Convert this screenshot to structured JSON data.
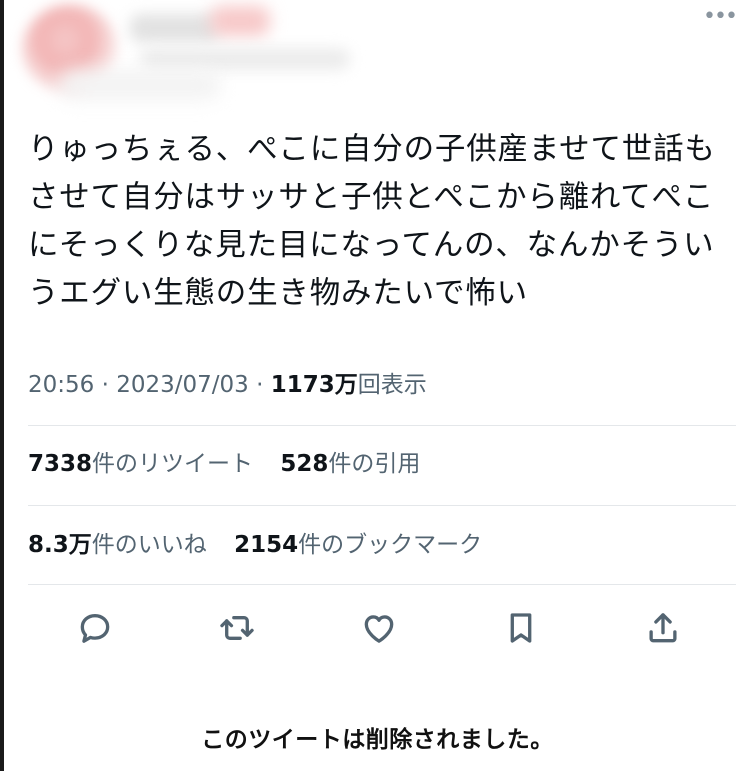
{
  "header": {
    "more_label": "•••"
  },
  "tweet": {
    "text": "りゅっちぇる、ぺこに自分の子供産ませて世話もさせて自分はサッサと子供とぺこから離れてぺこにそっくりな見た目になってんの、なんかそういうエグい生態の生き物みたいで怖い"
  },
  "meta": {
    "time": "20:56",
    "separator": " · ",
    "date": "2023/07/03",
    "views_count": "1173万",
    "views_label": "回表示"
  },
  "stats": {
    "retweets_count": "7338",
    "retweets_label": "件のリツイート",
    "quotes_count": "528",
    "quotes_label": "件の引用",
    "likes_count": "8.3万",
    "likes_label": "件のいいね",
    "bookmarks_count": "2154",
    "bookmarks_label": "件のブックマーク"
  },
  "actions": {
    "icons": [
      "reply-icon",
      "retweet-icon",
      "like-icon",
      "bookmark-icon",
      "share-icon"
    ]
  },
  "colors": {
    "text": "#0f1419",
    "secondary": "#536471",
    "divider": "#e4e7ea"
  },
  "footer": {
    "deleted_notice": "このツイートは削除されました。"
  }
}
